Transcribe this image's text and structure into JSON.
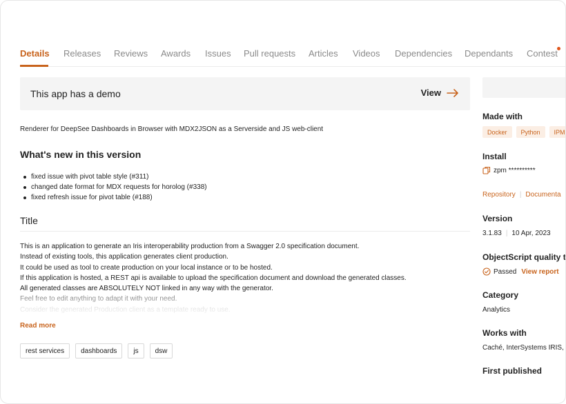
{
  "tabs": [
    {
      "label": "Details",
      "active": true
    },
    {
      "label": "Releases"
    },
    {
      "label": "Reviews"
    },
    {
      "label": "Awards"
    },
    {
      "label": "Issues"
    },
    {
      "label": "Pull requests"
    },
    {
      "label": "Articles"
    },
    {
      "label": "Videos"
    },
    {
      "label": "Dependencies"
    },
    {
      "label": "Dependants"
    },
    {
      "label": "Contest"
    }
  ],
  "demo": {
    "text": "This app has a demo",
    "view_label": "View"
  },
  "description": "Renderer for DeepSee Dashboards in Browser with MDX2JSON as a Serverside and JS web-client",
  "whats_new": {
    "heading": "What's new in this version",
    "items": [
      "fixed issue with pivot table style (#311)",
      "changed date format for MDX requests for horolog (#338)",
      "fixed refresh issue for pivot table (#188)"
    ]
  },
  "title_section": {
    "heading": "Title",
    "lines": [
      "This is an application to generate an Iris interoperability production from a Swagger 2.0 specification document.",
      "Instead of existing tools, this application generates client production.",
      "It could be used as tool to create production on your local instance or to be hosted.",
      "If this application is hosted, a REST api is available to upload the specification document and download the generated classes.",
      "All generated classes are ABSOLUTELY NOT linked in any way with the generator.",
      "Feel free to edit anything to adapt it with your need.",
      "Consider the generated Production client as a template ready to use."
    ],
    "read_more": "Read more"
  },
  "tags": [
    "rest services",
    "dashboards",
    "js",
    "dsw"
  ],
  "sidebar": {
    "made_with": {
      "heading": "Made with",
      "chips": [
        "Docker",
        "Python",
        "IPM"
      ]
    },
    "install": {
      "heading": "Install",
      "command": "zpm **********"
    },
    "links": {
      "repository": "Repository",
      "separator": "|",
      "documentation": "Documenta"
    },
    "version": {
      "heading": "Version",
      "number": "3.1.83",
      "separator": "|",
      "date": "10 Apr, 2023"
    },
    "quality": {
      "heading": "ObjectScript quality t",
      "status": "Passed",
      "view_report": "View report"
    },
    "category": {
      "heading": "Category",
      "value": "Analytics"
    },
    "works_with": {
      "heading": "Works with",
      "value": "Caché, InterSystems IRIS,"
    },
    "first_published": {
      "heading": "First published"
    }
  },
  "colors": {
    "accent": "#c8631c",
    "chip_bg": "#fbeee4",
    "banner_bg": "#f4f4f4"
  }
}
